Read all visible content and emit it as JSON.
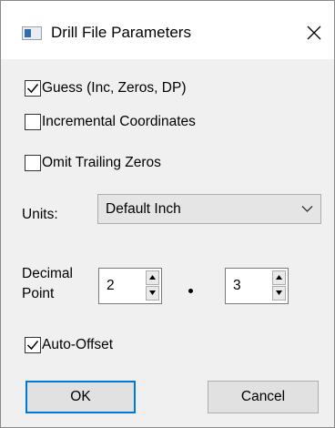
{
  "window": {
    "title": "Drill File Parameters"
  },
  "options": {
    "guess": {
      "label": "Guess (Inc, Zeros, DP)",
      "checked": true
    },
    "incremental": {
      "label": "Incremental Coordinates",
      "checked": false
    },
    "omit_trailing_zeros": {
      "label": "Omit Trailing Zeros",
      "checked": false
    },
    "auto_offset": {
      "label": "Auto-Offset",
      "checked": true
    }
  },
  "units": {
    "label": "Units:",
    "selected": "Default Inch"
  },
  "decimal_point": {
    "label_line1": "Decimal",
    "label_line2": "Point",
    "integer_digits": "2",
    "fraction_digits": "3"
  },
  "buttons": {
    "ok": "OK",
    "cancel": "Cancel"
  },
  "colors": {
    "default_button_border": "#0078d7",
    "dialog_background": "#f0f0f0",
    "title_background": "#ffffff"
  }
}
